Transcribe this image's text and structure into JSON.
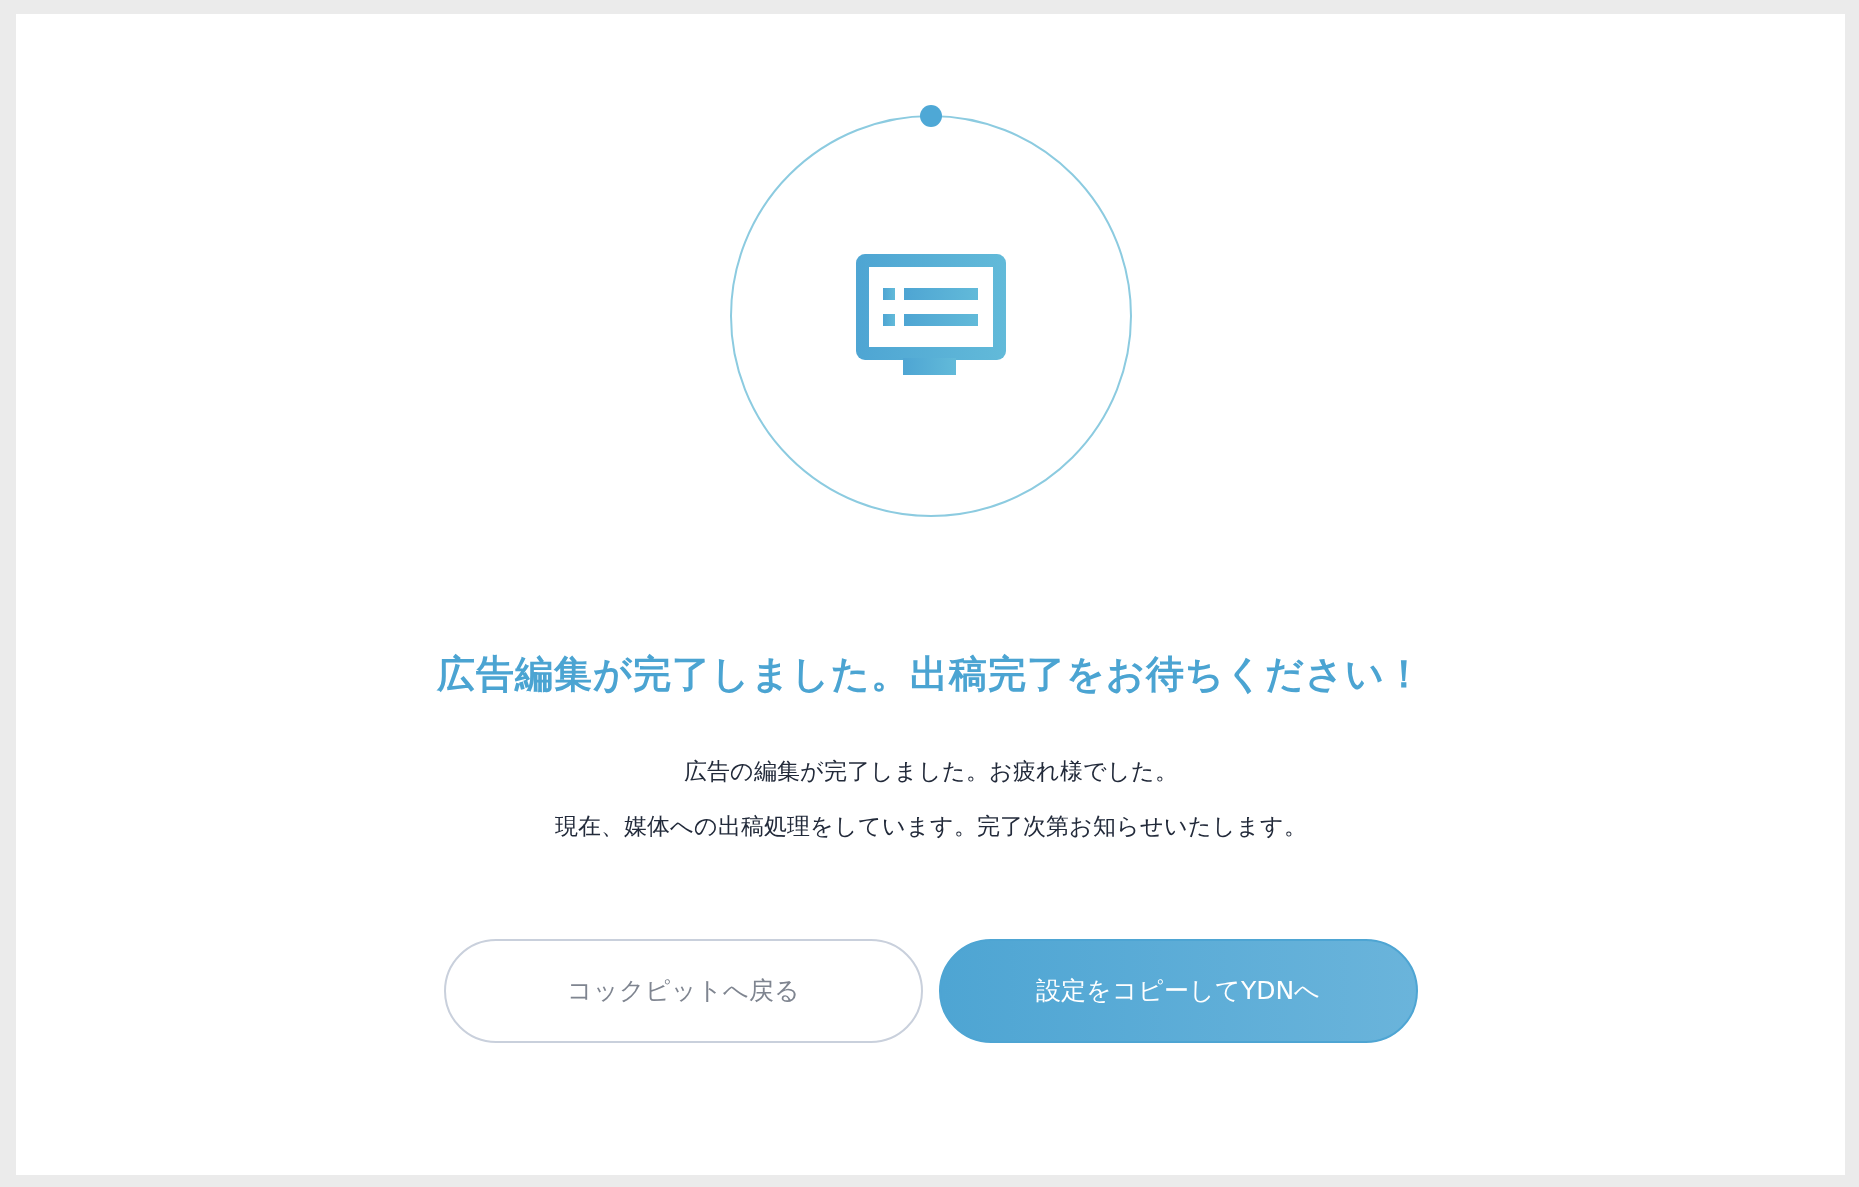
{
  "title": "広告編集が完了しました。出稿完了をお待ちください！",
  "messages": [
    "広告の編集が完了しました。お疲れ様でした。",
    "現在、媒体への出稿処理をしています。完了次第お知らせいたします。"
  ],
  "buttons": [
    {
      "label": "コックピットへ戻る",
      "kind": "secondary"
    },
    {
      "label": "設定をコピーしてYDNへ",
      "kind": "primary"
    }
  ]
}
